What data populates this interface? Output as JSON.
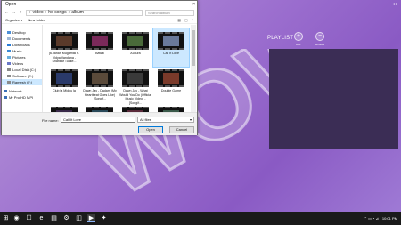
{
  "dialog": {
    "title": "Open",
    "close_glyph": "×",
    "back_glyph": "←",
    "forward_glyph": "→",
    "up_glyph": "↑",
    "path_sep": "›",
    "path": [
      "video",
      "hd songs",
      "album"
    ],
    "search_placeholder": "Search album",
    "organize_label": "Organize ▾",
    "new_folder_label": "New folder",
    "toolbar_icons": [
      "▦",
      "▢",
      "?"
    ],
    "nav_items": [
      {
        "label": "Desktop",
        "icon": "desktop-icon",
        "color": "#4d8fd8"
      },
      {
        "label": "Documents",
        "icon": "documents-icon",
        "color": "#9fb8d8"
      },
      {
        "label": "Downloads",
        "icon": "downloads-icon",
        "color": "#2a7dd8"
      },
      {
        "label": "Music",
        "icon": "music-icon",
        "color": "#3a8ad8"
      },
      {
        "label": "Pictures",
        "icon": "pictures-icon",
        "color": "#6ab0e0"
      },
      {
        "label": "Videos",
        "icon": "videos-icon",
        "color": "#6a78c8"
      },
      {
        "label": "Local Disk (C:)",
        "icon": "drive-icon",
        "color": "#8a8a8a"
      },
      {
        "label": "Software (E:)",
        "icon": "drive-icon",
        "color": "#8a8a8a"
      },
      {
        "label": "Ramesh (F:)",
        "icon": "drive-icon",
        "color": "#8a8a8a"
      },
      {
        "label": "Network",
        "icon": "network-icon",
        "color": "#3a6fb8"
      },
      {
        "label": "Mr Pro HD MPI",
        "icon": "computer-icon",
        "color": "#3a6fb8"
      }
    ],
    "files": [
      {
        "name": "(6.Jahan Mugamiki  ft. Vidya Vandana - Shankar Tucke...",
        "color": "#5a3a2a"
      },
      {
        "name": "Bawal",
        "color": "#7a2a5a"
      },
      {
        "name": "Aukura",
        "color": "#4a6a3a"
      },
      {
        "name": "Call It Love",
        "color": "#6a7a9a"
      },
      {
        "name": "Club la Middu la",
        "color": "#2a3a6a"
      },
      {
        "name": "Dawn Jay - Dadam (My Heartbeat Goes Like) (Songif...",
        "color": "#5a4a3a"
      },
      {
        "name": "Dawn Jay - What Would You Do (Official Music Video) - [Songif...",
        "color": "#3a3a3a"
      },
      {
        "name": "Double Game",
        "color": "#7a3a2a"
      },
      {
        "name": "",
        "color": "#3a2a4a"
      },
      {
        "name": "",
        "color": "#2a4a5a"
      },
      {
        "name": "",
        "color": "#5a2a3a"
      },
      {
        "name": "",
        "color": "#3a5a4a"
      }
    ],
    "selected_file_index": 3,
    "file_name_label": "File name:",
    "file_name_value": "Call It Love",
    "file_type_value": "All files",
    "dropdown_glyph": "▾",
    "open_label": "Open",
    "cancel_label": "Cancel"
  },
  "app": {
    "watermark_text": "WOW",
    "playlist_label": "PLAYLIST",
    "add_glyph": "+",
    "remove_glyph": "−",
    "add_caption": "Add",
    "remove_caption": "Remove",
    "top_dots": "••"
  },
  "taskbar": {
    "start_glyph": "⊞",
    "apps": [
      "◉",
      "☐",
      "e",
      "▤",
      "⚙",
      "◫",
      "▶",
      "✦"
    ],
    "active_index": 6,
    "tray_icons": "⌃  ▭  ◔  ⊿",
    "time": "10:01 PM",
    "date": "—"
  },
  "colors": {
    "selection": "#cce8ff",
    "taskbar": "#1a1a1a",
    "panel": "#3b2d55"
  }
}
